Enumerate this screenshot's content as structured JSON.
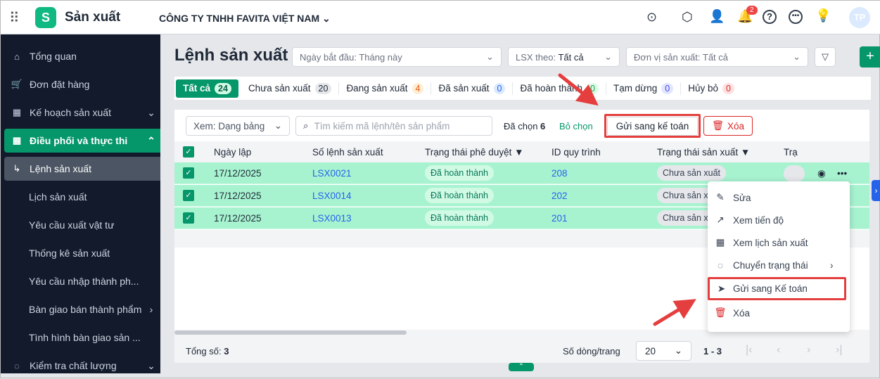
{
  "app": {
    "title": "Sản xuất",
    "company": "CÔNG TY TNHH FAVITA VIỆT NAM",
    "notif_count": "2",
    "avatar": "TP"
  },
  "sidebar": {
    "items": [
      {
        "label": "Tổng quan",
        "icon": "home-icon"
      },
      {
        "label": "Đơn đặt hàng",
        "icon": "cart-icon"
      },
      {
        "label": "Kế hoạch sản xuất",
        "icon": "calendar-icon"
      },
      {
        "label": "Điều phối và thực thi",
        "icon": "calendar-clock-icon"
      },
      {
        "label": "Lệnh sản xuất"
      },
      {
        "label": "Lịch sản xuất"
      },
      {
        "label": "Yêu cầu xuất vật tư"
      },
      {
        "label": "Thống kê sản xuất"
      },
      {
        "label": "Yêu cầu nhập thành ph..."
      },
      {
        "label": "Bàn giao bán thành phẩm"
      },
      {
        "label": "Tình hình bàn giao sản ..."
      },
      {
        "label": "Kiểm tra chất lượng",
        "icon": "check-circle-icon"
      }
    ]
  },
  "page": {
    "title": "Lệnh sản xuất"
  },
  "filters": {
    "start": "Ngày bắt đầu: Tháng này",
    "lsx_prefix": "LSX theo: ",
    "lsx_value": "Tất cả",
    "unit": "Đơn vị sản xuất: Tất cả"
  },
  "tabs": [
    {
      "label": "Tất cả",
      "count": "24"
    },
    {
      "label": "Chưa sản xuất",
      "count": "20"
    },
    {
      "label": "Đang sản xuất",
      "count": "4"
    },
    {
      "label": "Đã sản xuất",
      "count": "0"
    },
    {
      "label": "Đã hoàn thành",
      "count": "0"
    },
    {
      "label": "Tạm dừng",
      "count": "0"
    },
    {
      "label": "Hủy bỏ",
      "count": "0"
    }
  ],
  "toolbar": {
    "view": "Xem: Dạng bảng",
    "search_placeholder": "Tìm kiếm mã lệnh/tên sản phẩm",
    "selected_label": "Đã chọn",
    "selected_count": "6",
    "deselect": "Bỏ chọn",
    "send": "Gửi sang kế toán",
    "delete": "Xóa"
  },
  "table": {
    "headers": [
      "Ngày lập",
      "Số lệnh sản xuất",
      "Trạng thái phê duyệt",
      "ID quy trình",
      "Trạng thái sản xuất",
      "Trạ"
    ],
    "rows": [
      {
        "date": "17/12/2025",
        "code": "LSX0021",
        "approval": "Đã hoàn thành",
        "process": "208",
        "status": "Chưa sản xuất"
      },
      {
        "date": "17/12/2025",
        "code": "LSX0014",
        "approval": "Đã hoàn thành",
        "process": "202",
        "status": "Chưa sản x"
      },
      {
        "date": "17/12/2025",
        "code": "LSX0013",
        "approval": "Đã hoàn thành",
        "process": "201",
        "status": "Chưa sản x"
      }
    ]
  },
  "menu": [
    "Sửa",
    "Xem tiến độ",
    "Xem lịch sản xuất",
    "Chuyển trạng thái",
    "Gửi sang Kế toán",
    "Xóa"
  ],
  "footer": {
    "total_label": "Tổng số:",
    "total": "3",
    "rows_label": "Số dòng/trang",
    "page_size": "20",
    "range": "1 - 3"
  }
}
